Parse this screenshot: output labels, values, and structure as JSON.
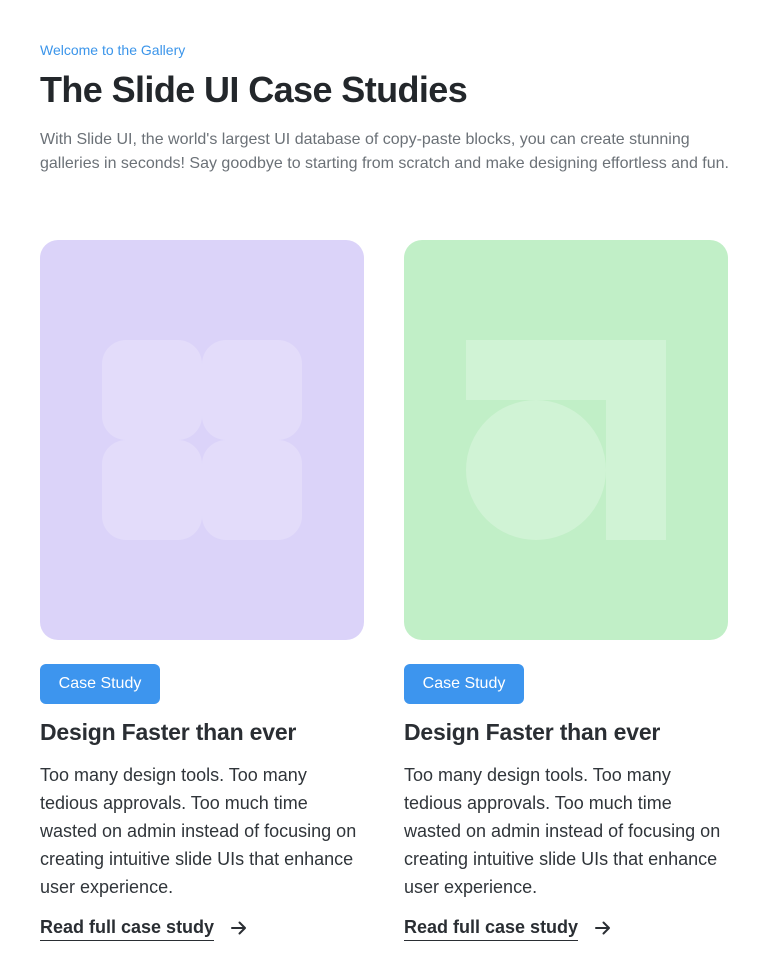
{
  "header": {
    "eyebrow": "Welcome to the Gallery",
    "title": "The Slide UI Case Studies",
    "intro": "With Slide UI, the world's largest UI database of copy-paste blocks, you can create stunning galleries in seconds! Say goodbye to starting from scratch and make designing effortless and fun."
  },
  "cards": [
    {
      "thumbnail_color": "#dbd3f9",
      "icon": "four-rounded-squares-icon",
      "badge": "Case Study",
      "title": "Design Faster than ever",
      "body": "Too many design tools. Too many tedious approvals. Too much time wasted on admin instead of focusing on creating intuitive slide UIs that enhance user experience.",
      "link": "Read full case study"
    },
    {
      "thumbnail_color": "#c1efc7",
      "icon": "circle-and-corner-bracket-icon",
      "badge": "Case Study",
      "title": "Design Faster than ever",
      "body": "Too many design tools. Too many tedious approvals. Too much time wasted on admin instead of focusing on creating intuitive slide UIs that enhance user experience.",
      "link": "Read full case study"
    }
  ],
  "colors": {
    "accent": "#3d95ee",
    "eyebrow": "#3b95ea",
    "heading": "#23272b",
    "muted_text": "#6b7177"
  }
}
